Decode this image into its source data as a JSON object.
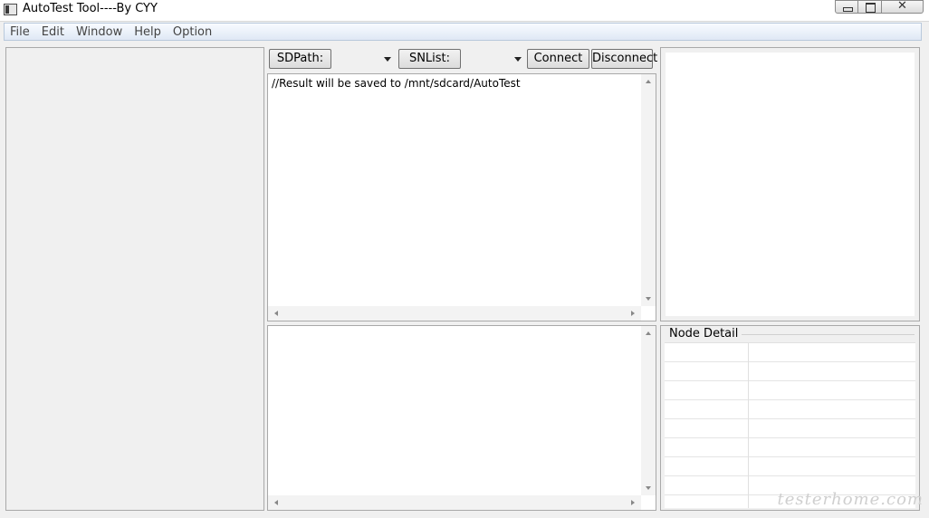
{
  "window": {
    "title": "AutoTest Tool----By CYY",
    "close_glyph": "✕"
  },
  "menu": {
    "items": [
      "File",
      "Edit",
      "Window",
      "Help",
      "Option"
    ]
  },
  "toolbar": {
    "sdpath_label": "SDPath:",
    "snlist_label": "SNList:",
    "connect_label": "Connect",
    "disconnect_label": "Disconnect",
    "sdpath_value": "",
    "snlist_value": ""
  },
  "result": {
    "text": "//Result will be saved to /mnt/sdcard/AutoTest"
  },
  "node_detail": {
    "title": "Node Detail"
  },
  "watermark": {
    "text": "testerhome.com"
  }
}
